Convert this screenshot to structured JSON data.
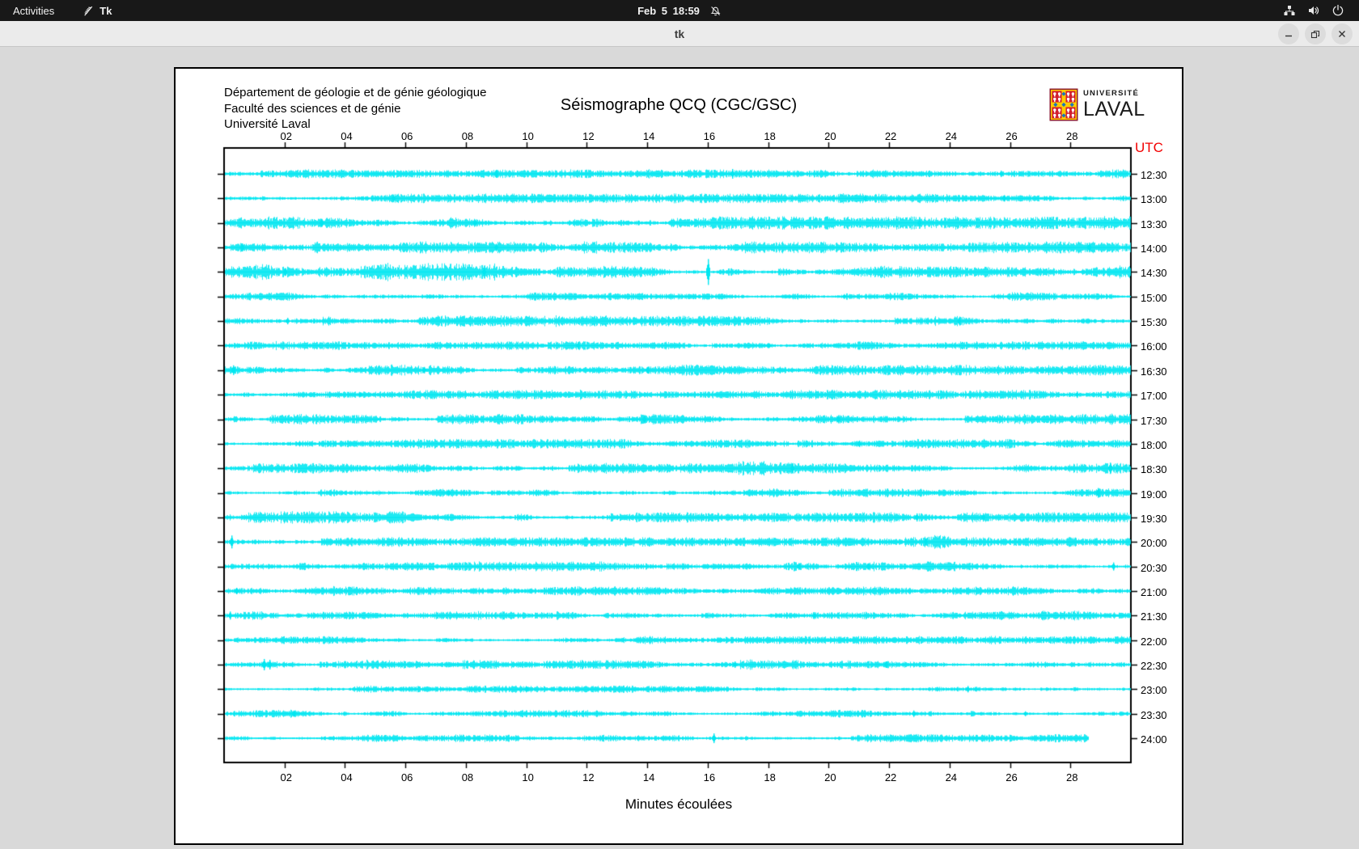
{
  "topbar": {
    "activities": "Activities",
    "app_name": "Tk",
    "clock": "Feb 5 18:59",
    "icons": [
      "tk-feather-icon",
      "notifications-muted-icon",
      "wired-network-icon",
      "volume-icon",
      "power-icon"
    ]
  },
  "window": {
    "title": "tk",
    "buttons": [
      "minimize",
      "maximize",
      "close"
    ]
  },
  "seismograph": {
    "address_lines": [
      "Département de géologie et de génie géologique",
      "Faculté des sciences et de génie",
      "Université Laval"
    ],
    "title": "Séismographe QCQ (CGC/GSC)",
    "logo": {
      "line1": "UNIVERSITÉ",
      "line2": "LAVAL"
    },
    "utc_label": "UTC",
    "xlabel": "Minutes écoulées",
    "colors": {
      "trace": "#00e6f0",
      "utc_red": "#f20000",
      "axis": "#000000",
      "background": "#ffffff",
      "desktop": "#d9d9d9"
    },
    "chart_data": {
      "type": "line",
      "x_range_minutes": [
        0,
        30
      ],
      "x_ticks": [
        "02",
        "04",
        "06",
        "08",
        "10",
        "12",
        "14",
        "16",
        "18",
        "20",
        "22",
        "24",
        "26",
        "28"
      ],
      "rows": [
        {
          "label": "12:30",
          "base_amp": 2.0,
          "end_min": 30,
          "spikes": [
            [
              9.0,
              5
            ],
            [
              16.8,
              6
            ],
            [
              25.7,
              4
            ]
          ],
          "patches": []
        },
        {
          "label": "13:00",
          "base_amp": 2.2,
          "end_min": 30,
          "spikes": [
            [
              5.6,
              4
            ],
            [
              17.7,
              5
            ],
            [
              21.2,
              4
            ],
            [
              25.8,
              4
            ]
          ],
          "patches": []
        },
        {
          "label": "13:30",
          "base_amp": 2.8,
          "end_min": 30,
          "spikes": [
            [
              3.2,
              5
            ],
            [
              8.3,
              4
            ],
            [
              23.0,
              4
            ]
          ],
          "patches": [
            [
              0,
              30,
              1.1
            ]
          ]
        },
        {
          "label": "14:00",
          "base_amp": 2.8,
          "end_min": 30,
          "spikes": [
            [
              0.6,
              5
            ],
            [
              9.0,
              4
            ],
            [
              28.6,
              6
            ]
          ],
          "patches": []
        },
        {
          "label": "14:30",
          "base_amp": 2.8,
          "end_min": 30,
          "spikes": [
            [
              16.0,
              16
            ],
            [
              8.6,
              5
            ],
            [
              2.0,
              4
            ]
          ],
          "patches": [
            [
              0,
              9,
              1.5
            ],
            [
              12,
              13,
              1.3
            ]
          ]
        },
        {
          "label": "15:00",
          "base_amp": 2.0,
          "end_min": 30,
          "spikes": [
            [
              20.5,
              3
            ]
          ],
          "patches": []
        },
        {
          "label": "15:30",
          "base_amp": 2.6,
          "end_min": 30,
          "spikes": [
            [
              2.1,
              4
            ],
            [
              24.3,
              4
            ]
          ],
          "patches": [
            [
              23.5,
              25,
              1.4
            ]
          ]
        },
        {
          "label": "16:00",
          "base_amp": 2.0,
          "end_min": 30,
          "spikes": [
            [
              11.7,
              4
            ],
            [
              18.0,
              3
            ]
          ],
          "patches": []
        },
        {
          "label": "16:30",
          "base_amp": 2.5,
          "end_min": 30,
          "spikes": [
            [
              0.3,
              6
            ],
            [
              6.6,
              4
            ],
            [
              14.0,
              4
            ]
          ],
          "patches": [
            [
              0,
              2,
              1.4
            ]
          ]
        },
        {
          "label": "17:00",
          "base_amp": 2.2,
          "end_min": 30,
          "spikes": [
            [
              4.5,
              3
            ],
            [
              28.2,
              4
            ]
          ],
          "patches": []
        },
        {
          "label": "17:30",
          "base_amp": 2.4,
          "end_min": 30,
          "spikes": [
            [
              13.9,
              4
            ],
            [
              20.3,
              5
            ]
          ],
          "patches": [
            [
              19.5,
              21.5,
              1.5
            ]
          ]
        },
        {
          "label": "18:00",
          "base_amp": 2.2,
          "end_min": 30,
          "spikes": [
            [
              2.5,
              3
            ],
            [
              21.0,
              4
            ]
          ],
          "patches": [
            [
              18.5,
              21,
              1.3
            ]
          ]
        },
        {
          "label": "18:30",
          "base_amp": 2.4,
          "end_min": 30,
          "spikes": [
            [
              18.8,
              5
            ],
            [
              29.3,
              7
            ]
          ],
          "patches": [
            [
              17,
              19.5,
              1.4
            ]
          ]
        },
        {
          "label": "19:00",
          "base_amp": 2.1,
          "end_min": 30,
          "spikes": [
            [
              7.4,
              4
            ],
            [
              28.9,
              6
            ]
          ],
          "patches": []
        },
        {
          "label": "19:30",
          "base_amp": 2.4,
          "end_min": 30,
          "spikes": [
            [
              22.9,
              5
            ],
            [
              25.1,
              5
            ]
          ],
          "patches": [
            [
              0,
              6,
              1.2
            ]
          ]
        },
        {
          "label": "20:00",
          "base_amp": 2.2,
          "end_min": 30,
          "spikes": [
            [
              0.25,
              8
            ],
            [
              23.2,
              4
            ]
          ],
          "patches": [
            [
              22.5,
              24,
              1.4
            ]
          ]
        },
        {
          "label": "20:30",
          "base_amp": 2.3,
          "end_min": 30,
          "spikes": [
            [
              19.0,
              4
            ],
            [
              21.3,
              4
            ],
            [
              29.4,
              5
            ]
          ],
          "patches": [
            [
              18.5,
              21.5,
              1.4
            ]
          ]
        },
        {
          "label": "21:00",
          "base_amp": 2.2,
          "end_min": 30,
          "spikes": [
            [
              0.4,
              4
            ],
            [
              16.5,
              3
            ]
          ],
          "patches": []
        },
        {
          "label": "21:30",
          "base_amp": 2.1,
          "end_min": 30,
          "spikes": [
            [
              0.2,
              5
            ],
            [
              19.5,
              4
            ]
          ],
          "patches": []
        },
        {
          "label": "22:00",
          "base_amp": 1.9,
          "end_min": 30,
          "spikes": [
            [
              27.6,
              3
            ]
          ],
          "patches": []
        },
        {
          "label": "22:30",
          "base_amp": 2.1,
          "end_min": 30,
          "spikes": [
            [
              1.3,
              7
            ],
            [
              1.5,
              6
            ],
            [
              16.9,
              4
            ],
            [
              21.9,
              4
            ]
          ],
          "patches": [
            [
              16.5,
              17.5,
              1.3
            ],
            [
              21.5,
              22.3,
              1.3
            ]
          ]
        },
        {
          "label": "23:00",
          "base_amp": 1.7,
          "end_min": 30,
          "spikes": [
            [
              10.0,
              3
            ],
            [
              24.6,
              4
            ]
          ],
          "patches": []
        },
        {
          "label": "23:30",
          "base_amp": 1.8,
          "end_min": 30,
          "spikes": [
            [
              2.3,
              4
            ],
            [
              22.8,
              4
            ],
            [
              26.5,
              3
            ]
          ],
          "patches": [
            [
              22.5,
              23.2,
              1.4
            ]
          ]
        },
        {
          "label": "24:00",
          "base_amp": 1.9,
          "end_min": 28.6,
          "spikes": [
            [
              16.2,
              6
            ]
          ],
          "patches": []
        }
      ]
    }
  }
}
